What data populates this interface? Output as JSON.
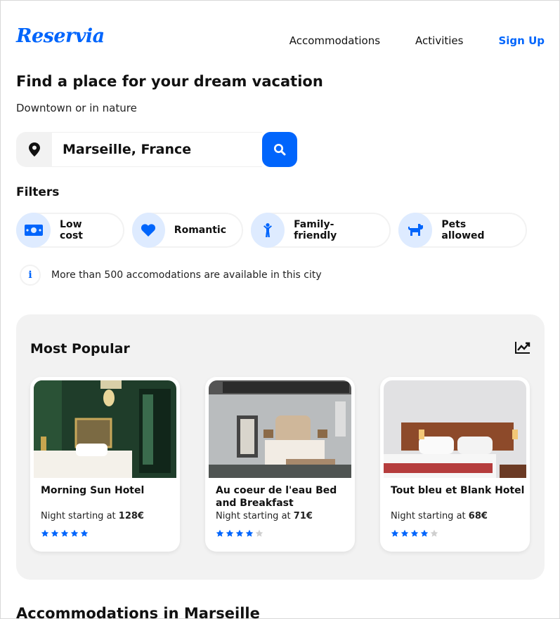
{
  "brand": {
    "logo": "Reservia",
    "accent": "#0065fc"
  },
  "nav": {
    "items": [
      "Accommodations",
      "Activities"
    ],
    "signup": "Sign Up"
  },
  "hero": {
    "title": "Find a place for your dream vacation",
    "subtitle": "Downtown or in nature"
  },
  "search": {
    "value": "Marseille, France",
    "pin_icon": "map-pin-icon",
    "button_icon": "search-icon"
  },
  "filters": {
    "title": "Filters",
    "items": [
      {
        "label": "Low cost",
        "icon": "money-icon"
      },
      {
        "label": "Romantic",
        "icon": "heart-icon"
      },
      {
        "label": "Family-friendly",
        "icon": "child-icon"
      },
      {
        "label": "Pets allowed",
        "icon": "dog-icon"
      }
    ]
  },
  "info": {
    "text": "More than 500 accomodations are available in this city"
  },
  "popular": {
    "title": "Most Popular",
    "icon": "trend-chart-icon",
    "cards": [
      {
        "name": "Morning Sun Hotel",
        "price_prefix": "Night starting at",
        "price": "128€",
        "rating": 5
      },
      {
        "name": "Au coeur de l'eau Bed and Breakfast",
        "price_prefix": "Night starting at",
        "price": "71€",
        "rating": 4
      },
      {
        "name": "Tout bleu et Blank Hotel",
        "price_prefix": "Night starting at",
        "price": "68€",
        "rating": 4
      }
    ]
  },
  "accommodations": {
    "title": "Accommodations in Marseille"
  }
}
